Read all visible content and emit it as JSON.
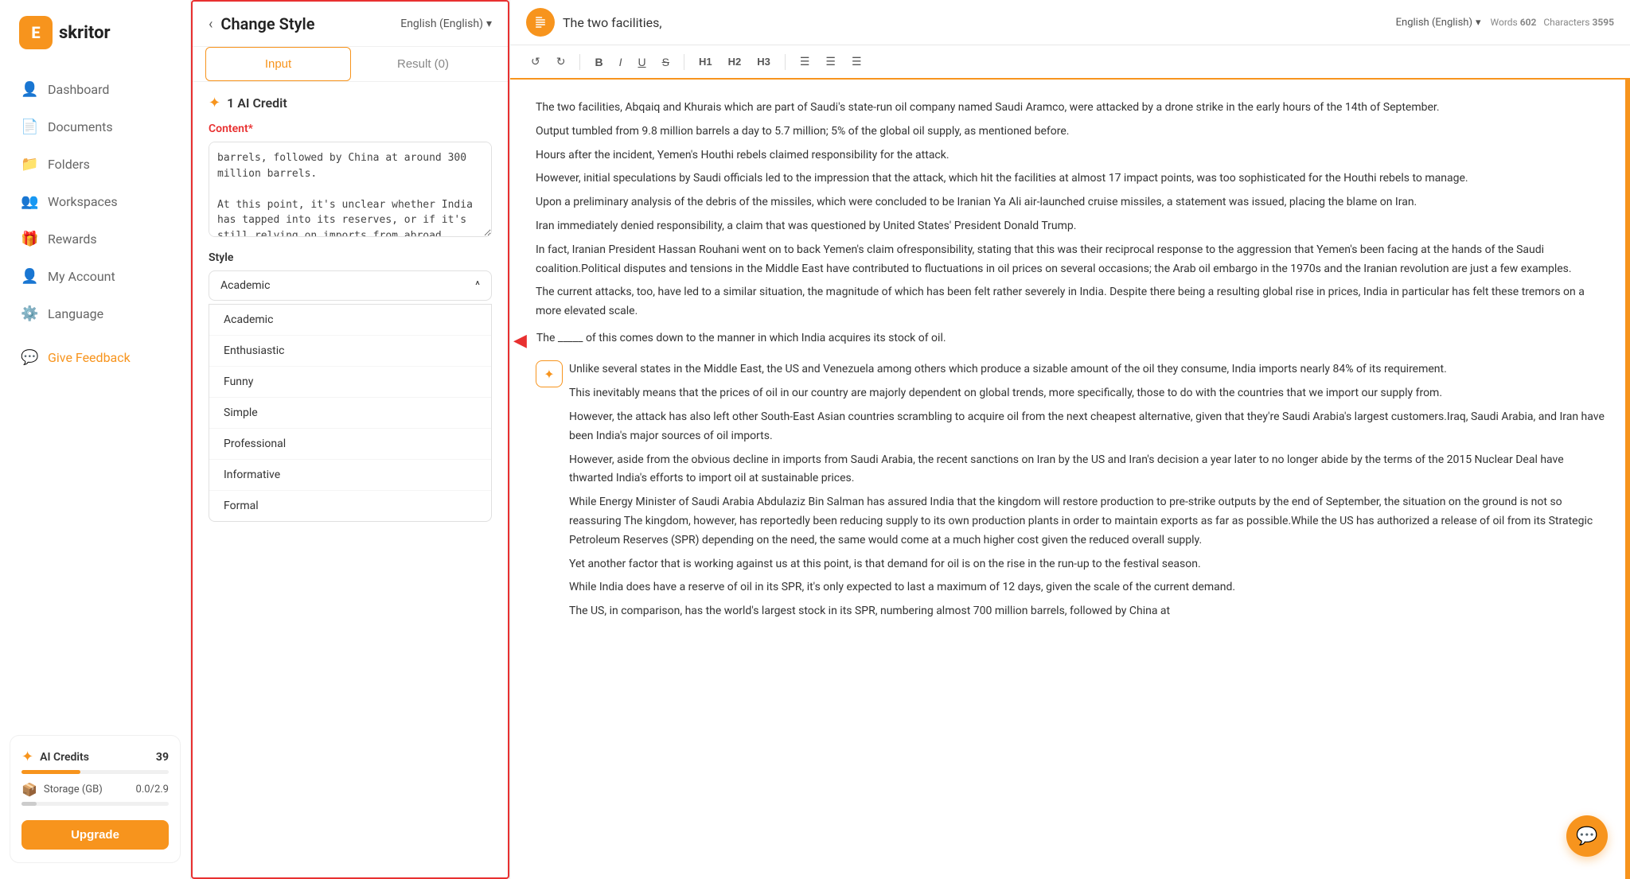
{
  "sidebar": {
    "logo_letter": "E",
    "logo_name": "skritor",
    "nav_items": [
      {
        "id": "dashboard",
        "label": "Dashboard",
        "icon": "👤"
      },
      {
        "id": "documents",
        "label": "Documents",
        "icon": "📄"
      },
      {
        "id": "folders",
        "label": "Folders",
        "icon": "📁"
      },
      {
        "id": "workspaces",
        "label": "Workspaces",
        "icon": "👥"
      },
      {
        "id": "rewards",
        "label": "Rewards",
        "icon": "🎁"
      },
      {
        "id": "my-account",
        "label": "My Account",
        "icon": "👤"
      },
      {
        "id": "language",
        "label": "Language",
        "icon": "⚙️"
      }
    ],
    "give_feedback": "Give Feedback",
    "credits_label": "AI Credits",
    "credits_count": "39",
    "storage_label": "Storage (GB)",
    "storage_value": "0.0/2.9",
    "upgrade_label": "Upgrade"
  },
  "change_style_panel": {
    "back_label": "‹",
    "title": "Change Style",
    "language": "English (English)",
    "language_arrow": "▾",
    "tab_input": "Input",
    "tab_result": "Result (0)",
    "ai_credit_icon": "✦",
    "ai_credit_label": "1 AI Credit",
    "content_label": "Content",
    "content_required": "*",
    "textarea_value": "barrels, followed by China at around 300 million barrels.\n\nAt this point, it's unclear whether India has tapped into its reserves, or if it's still relying on imports from abroad.",
    "style_label": "Style",
    "style_selected": "Academic",
    "style_arrow": "^",
    "style_options": [
      {
        "id": "academic",
        "label": "Academic"
      },
      {
        "id": "enthusiastic",
        "label": "Enthusiastic"
      },
      {
        "id": "funny",
        "label": "Funny"
      },
      {
        "id": "simple",
        "label": "Simple"
      },
      {
        "id": "professional",
        "label": "Professional"
      },
      {
        "id": "informative",
        "label": "Informative"
      },
      {
        "id": "formal",
        "label": "Formal"
      }
    ]
  },
  "editor": {
    "doc_title": "The two facilities,",
    "language": "English (English)",
    "language_arrow": "▾",
    "words_label": "Words",
    "words_count": "602",
    "chars_label": "Characters",
    "chars_count": "3595",
    "toolbar_buttons": [
      {
        "id": "undo",
        "label": "↺"
      },
      {
        "id": "redo",
        "label": "↻"
      },
      {
        "id": "bold",
        "label": "B"
      },
      {
        "id": "italic",
        "label": "I"
      },
      {
        "id": "underline",
        "label": "U"
      },
      {
        "id": "strikethrough",
        "label": "S"
      },
      {
        "id": "h1",
        "label": "H1"
      },
      {
        "id": "h2",
        "label": "H2"
      },
      {
        "id": "h3",
        "label": "H3"
      },
      {
        "id": "ordered-list",
        "label": "≡"
      },
      {
        "id": "unordered-list",
        "label": "≡"
      },
      {
        "id": "align",
        "label": "≡"
      }
    ],
    "content_paragraphs": [
      "The two facilities, Abqaiq and Khurais which are part of Saudi's state-run oil company named Saudi Aramco, were attacked by a drone strike in the early hours of the 14th of September.",
      "Output tumbled from 9.8 million barrels a day to 5.7 million; 5% of the global oil supply, as mentioned before.",
      "Hours after the incident, Yemen's Houthi rebels claimed responsibility for the attack.",
      "However, initial speculations by Saudi officials led to the impression that the attack, which hit the facilities at almost 17 impact points, was too sophisticated for the Houthi rebels to manage.",
      "Upon a preliminary analysis of the debris of the missiles, which were concluded to be Iranian Ya Ali air-launched cruise missiles, a statement was issued, placing the blame on Iran.",
      "Iran immediately denied responsibility, a claim that was questioned by United States' President Donald Trump.",
      "In fact, Iranian President Hassan Rouhani went on to back Yemen's claim ofresponsibility, stating that this was their reciprocal response to the aggression that Yemen's been facing at the hands of the Saudi coalition.Political disputes and tensions in the Middle East have contributed to fluctuations in oil prices on several occasions; the Arab oil embargo in the 1970s and the Iranian revolution are just a few examples.",
      "The current attacks, too, have led to a similar situation, the magnitude of which has been felt rather severely in India. Despite there being a resulting global rise in prices, India in particular has felt these tremors on a more elevated scale.",
      "The _____ of this comes down to the manner in which India acquires its stock of oil.",
      "Unlike several states in the Middle East, the US and Venezuela among others which produce a sizable amount of the oil they consume, India imports nearly 84% of its requirement.",
      "This inevitably means that the prices of oil in our country are majorly dependent on global trends, more specifically, those to do with the countries that we import our supply from.",
      "However, the attack has also left other South-East Asian countries scrambling to acquire oil from the next cheapest alternative, given that they're Saudi Arabia's largest customers.Iraq, Saudi Arabia, and Iran have been India's major sources of oil imports.",
      "However, aside from the obvious decline in imports from Saudi Arabia, the recent sanctions on Iran by the US and Iran's decision a year later to no longer abide by the terms of the 2015 Nuclear Deal have thwarted India's efforts to import oil at sustainable prices.",
      "While Energy Minister of Saudi Arabia Abdulaziz Bin Salman has assured India that the kingdom will restore production to pre-strike outputs by the end of September, the situation on the ground is not so reassuring The kingdom, however, has reportedly been reducing supply to its own production plants in order to maintain exports as far as possible.While the US has authorized a release of oil from its Strategic Petroleum Reserves (SPR) depending on the need, the same would come at a much higher cost given the reduced overall supply.",
      "Yet another factor that is working against us at this point, is that demand for oil is on the rise in the run-up to the festival season.",
      "While India does have a reserve of oil in its SPR, it's only expected to last a maximum of 12 days, given the scale of the current demand.",
      "The US, in comparison, has the world's largest stock in its SPR, numbering almost 700 million barrels, followed by China at"
    ]
  },
  "chat_fab_icon": "💬"
}
